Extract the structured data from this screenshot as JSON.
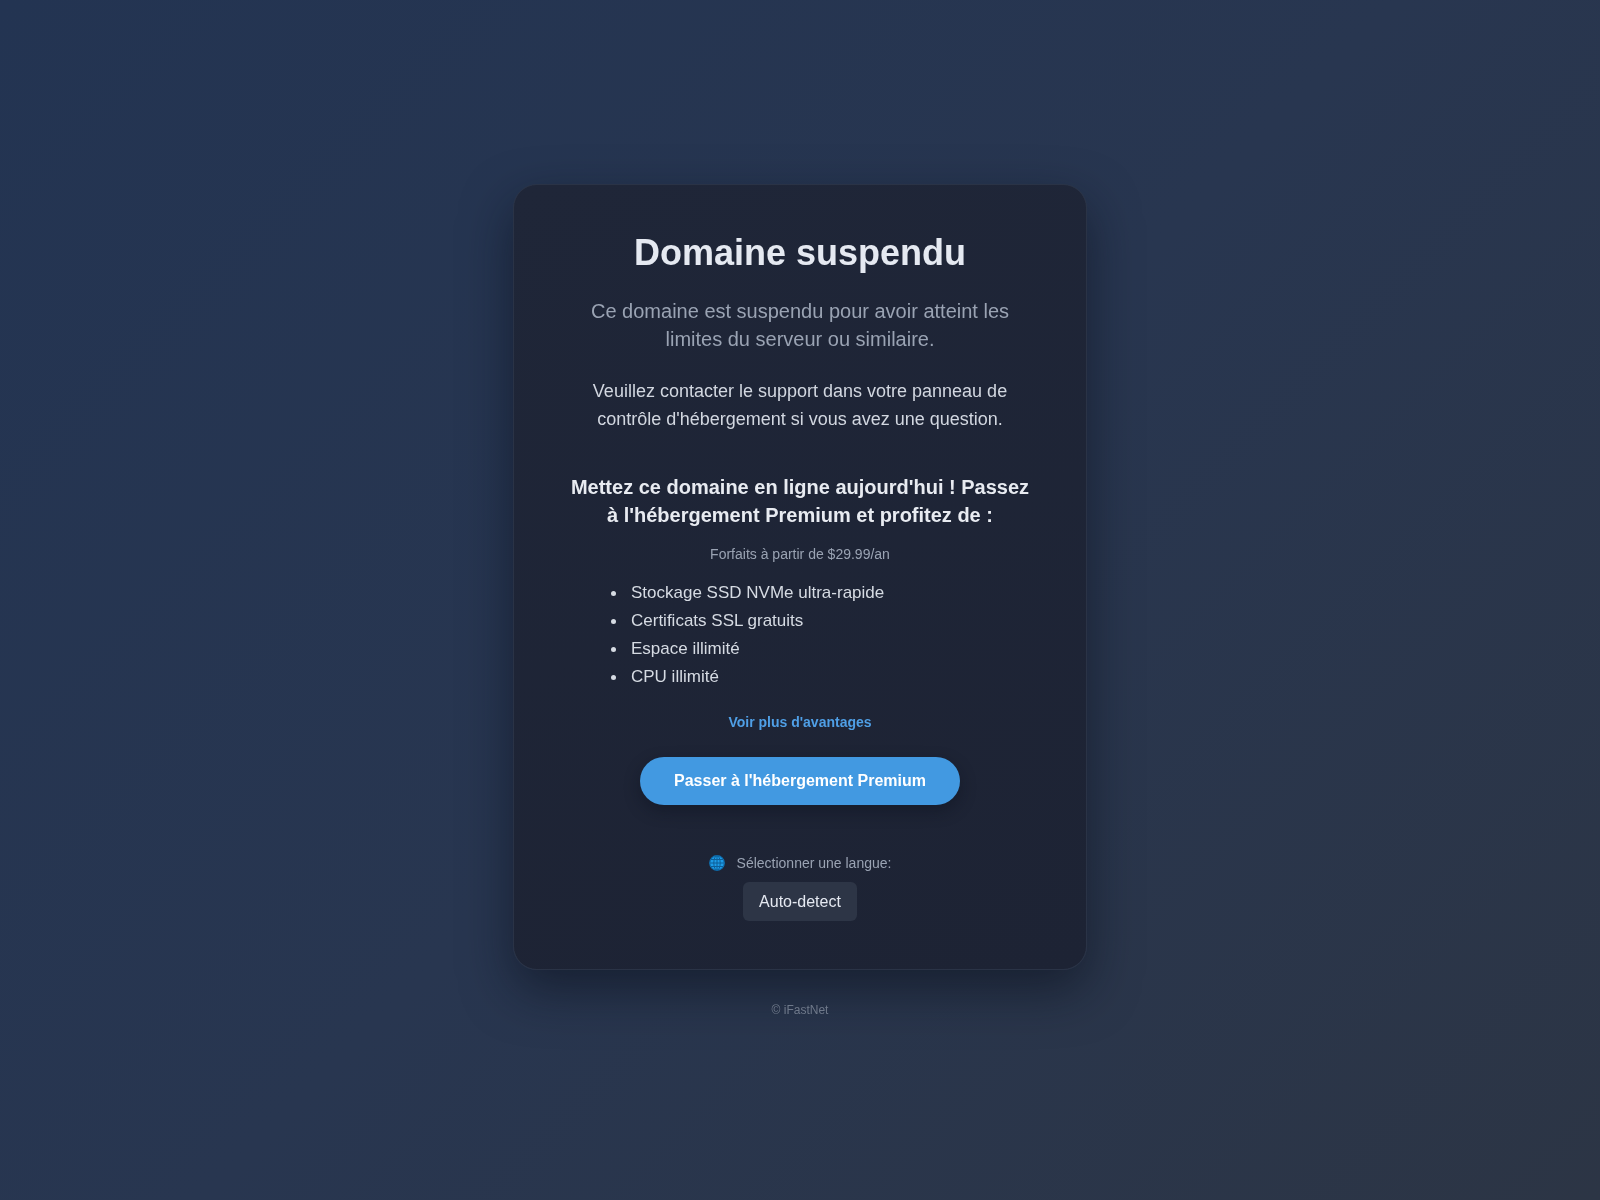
{
  "card": {
    "title": "Domaine suspendu",
    "subtitle": "Ce domaine est suspendu pour avoir atteint les limites du serveur ou similaire.",
    "message": "Veuillez contacter le support dans votre panneau de contrôle d'hébergement si vous avez une question.",
    "promo": {
      "heading": "Mettez ce domaine en ligne aujourd'hui ! Passez à l'hébergement Premium et profitez de :",
      "price_note": "Forfaits à partir de $29.99/an",
      "features": [
        "Stockage SSD NVMe ultra-rapide",
        "Certificats SSL gratuits",
        "Espace illimité",
        "CPU illimité"
      ],
      "more_link": "Voir plus d'avantages",
      "cta_button": "Passer à l'hébergement Premium"
    },
    "language": {
      "label": "Sélectionner une langue:",
      "select_value": "Auto-detect"
    }
  },
  "footer": "© iFastNet"
}
